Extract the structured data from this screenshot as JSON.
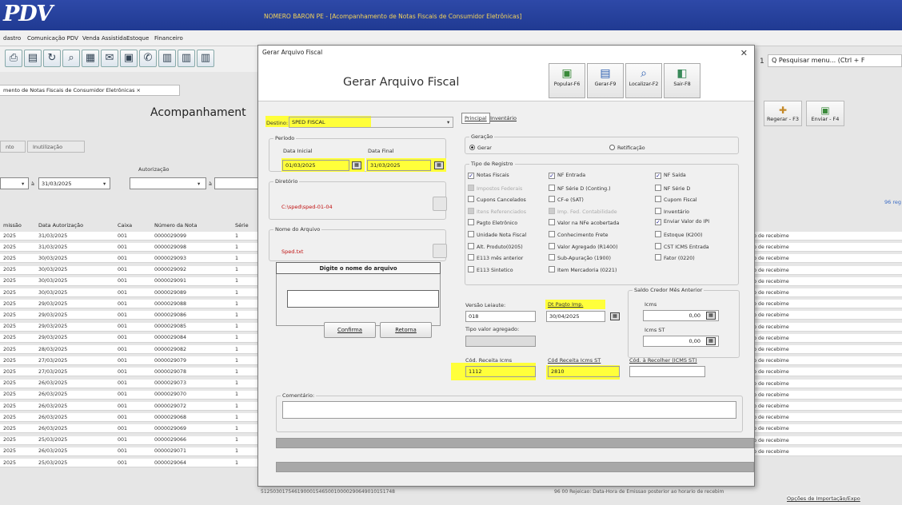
{
  "app": {
    "logo": "PDV",
    "title": "NOMERO BARON PE - [Acompanhamento de Notas Fiscais de Consumidor Eletrônicas]",
    "menu": [
      "dastro",
      "Comunicação PDV",
      "Venda Assistida",
      "Estoque",
      "Financeiro"
    ],
    "toolbar_icons": [
      "print-icon",
      "open-icon",
      "refresh-icon",
      "search-icon",
      "table-icon",
      "email-icon",
      "window-icon",
      "phone-icon",
      "report-icon",
      "report2-icon",
      "report3-icon"
    ],
    "doc_tab": "mento de Notas Fiscais de Consumidor Eletrônicas  ×",
    "page_title": "Acompanhament",
    "bg_tabs": [
      "nto",
      "Inutilização"
    ],
    "autorizacao_label": "Autorização",
    "filter_date_to": "31/03/2025",
    "search_placeholder": "Q Pesquisar menu... (Ctrl + F",
    "right_buttons": [
      {
        "label": "Regerar - F3",
        "icon": "regenerate-icon"
      },
      {
        "label": "Enviar - F4",
        "icon": "send-icon"
      }
    ],
    "right_count": "96 reg",
    "bottom_right_link": "Opções de Importação/Expo",
    "bottom_row_text": "51250301754619000154650010000290649010151748",
    "bottom_row_status": "96 00  Rejeicao: Data-Hora de Emissao posterior ao horario de recebim"
  },
  "grid": {
    "headers": [
      "missão",
      "Data Autorização",
      "Caixa",
      "Número da Nota",
      "Série"
    ],
    "rows": [
      [
        "2025",
        "31/03/2025",
        "001",
        "0000029099",
        "1"
      ],
      [
        "2025",
        "31/03/2025",
        "001",
        "0000029098",
        "1"
      ],
      [
        "2025",
        "30/03/2025",
        "001",
        "0000029093",
        "1"
      ],
      [
        "2025",
        "30/03/2025",
        "001",
        "0000029092",
        "1"
      ],
      [
        "2025",
        "30/03/2025",
        "001",
        "0000029091",
        "1"
      ],
      [
        "2025",
        "30/03/2025",
        "001",
        "0000029089",
        "1"
      ],
      [
        "2025",
        "29/03/2025",
        "001",
        "0000029088",
        "1"
      ],
      [
        "2025",
        "29/03/2025",
        "001",
        "0000029086",
        "1"
      ],
      [
        "2025",
        "29/03/2025",
        "001",
        "0000029085",
        "1"
      ],
      [
        "2025",
        "29/03/2025",
        "001",
        "0000029084",
        "1"
      ],
      [
        "2025",
        "28/03/2025",
        "001",
        "0000029082",
        "1"
      ],
      [
        "2025",
        "27/03/2025",
        "001",
        "0000029079",
        "1"
      ],
      [
        "2025",
        "27/03/2025",
        "001",
        "0000029078",
        "1"
      ],
      [
        "2025",
        "26/03/2025",
        "001",
        "0000029073",
        "1"
      ],
      [
        "2025",
        "26/03/2025",
        "001",
        "0000029070",
        "1"
      ],
      [
        "2025",
        "26/03/2025",
        "001",
        "0000029072",
        "1"
      ],
      [
        "2025",
        "26/03/2025",
        "001",
        "0000029068",
        "1"
      ],
      [
        "2025",
        "26/03/2025",
        "001",
        "0000029069",
        "1"
      ],
      [
        "2025",
        "25/03/2025",
        "001",
        "0000029066",
        "1"
      ],
      [
        "2025",
        "26/03/2025",
        "001",
        "0000029071",
        "1"
      ],
      [
        "2025",
        "25/03/2025",
        "001",
        "0000029064",
        "1"
      ]
    ],
    "status_text": "rio de recebime"
  },
  "dialog": {
    "window_title": "Gerar Arquivo Fiscal",
    "heading": "Gerar Arquivo Fiscal",
    "header_buttons": [
      {
        "label": "Popular-F6",
        "icon": "populate-icon"
      },
      {
        "label": "Gerar-F9",
        "icon": "save-icon"
      },
      {
        "label": "Localizar-F2",
        "icon": "search-icon"
      },
      {
        "label": "Sair-F8",
        "icon": "exit-icon"
      }
    ],
    "destino_label": "Destino:",
    "destino_value": "SPED FISCAL",
    "tabs": [
      "Principal",
      "Inventário"
    ],
    "periodo": {
      "title": "Período",
      "ini_label": "Data Inicial",
      "ini_value": "01/03/2025",
      "fim_label": "Data Final",
      "fim_value": "31/03/2025"
    },
    "diretorio": {
      "title": "Diretório",
      "value": "C:\\sped\\sped-01-04"
    },
    "arquivo": {
      "title": "Nome do Arquivo",
      "value": "Sped.txt",
      "prompt": "Digite o nome do arquivo"
    },
    "confirma": "Confirma",
    "retorna": "Retorna",
    "geracao": {
      "title": "Geração",
      "opt1": "Gerar",
      "opt2": "Retificação"
    },
    "tipo_registro": {
      "title": "Tipo de Registro",
      "col1": [
        {
          "label": "Notas Fiscais",
          "checked": true,
          "disabled": false
        },
        {
          "label": "Impostos Federais",
          "checked": false,
          "disabled": true
        },
        {
          "label": "Cupons Cancelados",
          "checked": false,
          "disabled": false
        },
        {
          "label": "Itens Referenciados",
          "checked": false,
          "disabled": true
        },
        {
          "label": "Pagto Eletrônico",
          "checked": false,
          "disabled": false
        },
        {
          "label": "Unidade Nota Fiscal",
          "checked": false,
          "disabled": false
        },
        {
          "label": "Alt. Produto(0205)",
          "checked": false,
          "disabled": false
        },
        {
          "label": "E113 mês anterior",
          "checked": false,
          "disabled": false
        },
        {
          "label": "E113 Sintetico",
          "checked": false,
          "disabled": false
        }
      ],
      "col2": [
        {
          "label": "NF Entrada",
          "checked": true,
          "disabled": false
        },
        {
          "label": "NF Série D (Conting.)",
          "checked": false,
          "disabled": false
        },
        {
          "label": "CF-e (SAT)",
          "checked": false,
          "disabled": false
        },
        {
          "label": "Imp. Fed. Contabilidade",
          "checked": false,
          "disabled": true
        },
        {
          "label": "Valor na NFe acobertada",
          "checked": false,
          "disabled": false
        },
        {
          "label": "Conhecimento Frete",
          "checked": false,
          "disabled": false
        },
        {
          "label": "Valor Agregado (R1400)",
          "checked": false,
          "disabled": false
        },
        {
          "label": "Sub-Apuração (1900)",
          "checked": false,
          "disabled": false
        },
        {
          "label": "Item Mercadoria (0221)",
          "checked": false,
          "disabled": false
        }
      ],
      "col3": [
        {
          "label": "NF Saída",
          "checked": true,
          "disabled": false
        },
        {
          "label": "NF Série D",
          "checked": false,
          "disabled": false
        },
        {
          "label": "Cupom Fiscal",
          "checked": false,
          "disabled": false
        },
        {
          "label": "Inventário",
          "checked": false,
          "disabled": false
        },
        {
          "label": "Enviar Valor do IPI",
          "checked": true,
          "disabled": false
        },
        {
          "label": "Estoque (K200)",
          "checked": false,
          "disabled": false
        },
        {
          "label": "CST ICMS Entrada",
          "checked": false,
          "disabled": false
        },
        {
          "label": "Fator (0220)",
          "checked": false,
          "disabled": false
        }
      ]
    },
    "versao_label": "Versão Leiaute:",
    "versao_value": "018",
    "dt_pagto_label": "Dt Pagto Imp.",
    "dt_pagto_value": "30/04/2025",
    "tipo_valor_label": "Tipo valor agregado:",
    "saldo": {
      "title": "Saldo Credor Mês Anterior",
      "icms_label": "Icms",
      "icms_value": "0,00",
      "icms_st_label": "Icms ST",
      "icms_st_value": "0,00"
    },
    "cod_receita_icms_label": "Cód. Receita Icms",
    "cod_receita_icms_value": "1112",
    "cod_receita_st_label": "Cód Receita Icms ST",
    "cod_receita_st_value": "2810",
    "cod_recolher_label": "Cód. à Recolher (ICMS ST)",
    "comentario_label": "Comentário:"
  }
}
